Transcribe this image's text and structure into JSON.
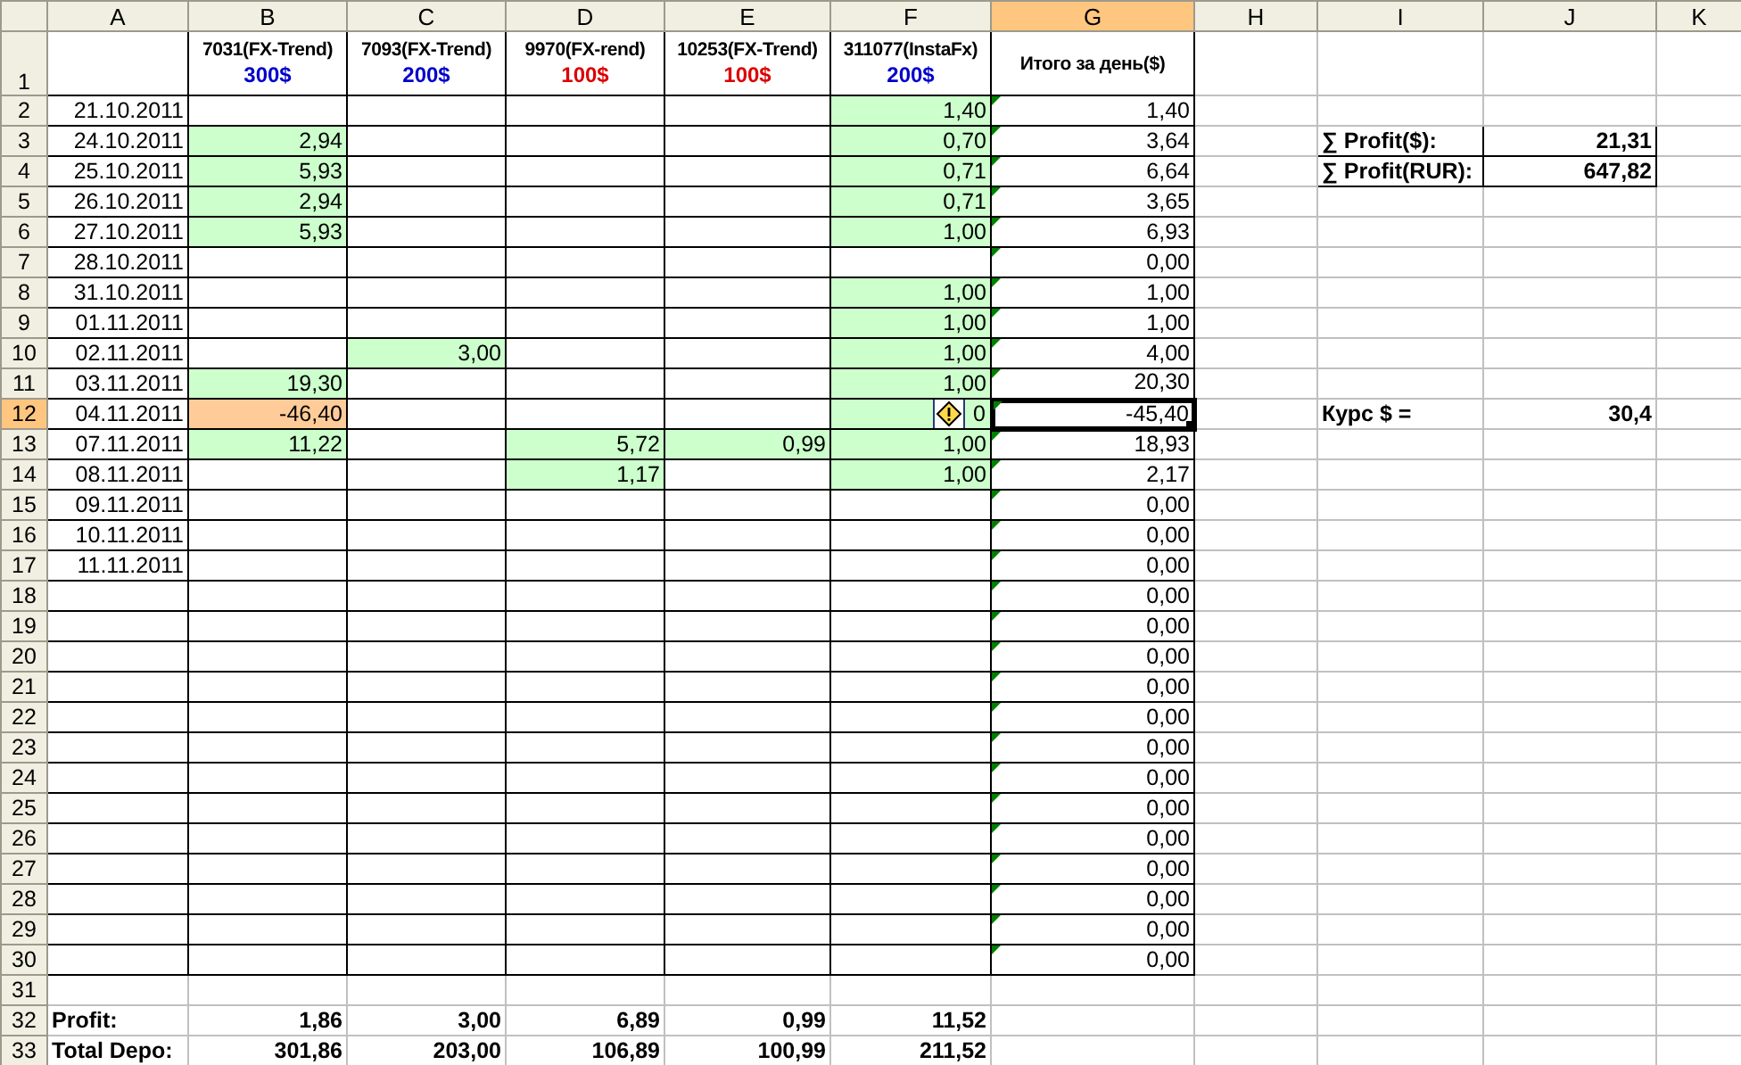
{
  "columns": [
    {
      "label": "A",
      "selected": false
    },
    {
      "label": "B",
      "selected": false
    },
    {
      "label": "C",
      "selected": false
    },
    {
      "label": "D",
      "selected": false
    },
    {
      "label": "E",
      "selected": false
    },
    {
      "label": "F",
      "selected": false
    },
    {
      "label": "G",
      "selected": true
    },
    {
      "label": "H",
      "selected": false
    },
    {
      "label": "I",
      "selected": false
    },
    {
      "label": "J",
      "selected": false
    },
    {
      "label": "K",
      "selected": false
    }
  ],
  "rows": [
    {
      "label": "1",
      "selected": false,
      "ruled": true,
      "cells": [
        {},
        {
          "kind": "header",
          "text": "7031(FX-Trend)",
          "amount": "300$",
          "color": "#0000cc",
          "selected": false
        },
        {
          "kind": "header",
          "text": "7093(FX-Trend)",
          "amount": "200$",
          "color": "#0000cc",
          "selected": false
        },
        {
          "kind": "header",
          "text": "9970(FX-rend)",
          "amount": "100$",
          "color": "#dd0000",
          "selected": false
        },
        {
          "kind": "header",
          "text": "10253(FX-Trend)",
          "amount": "100$",
          "color": "#dd0000",
          "selected": false
        },
        {
          "kind": "header",
          "text": "311077(InstaFx)",
          "amount": "200$",
          "color": "#0000cc",
          "selected": false
        },
        {
          "kind": "header",
          "text": "Итого за день($)",
          "selected": false
        }
      ]
    },
    {
      "label": "2",
      "selected": false,
      "ruled": true,
      "cells": [
        {
          "kind": "date",
          "text": "21.10.2011",
          "selected": false
        },
        {},
        {},
        {},
        {},
        {
          "kind": "number",
          "text": "1,40",
          "color": "#ccffcc",
          "selected": false
        },
        {
          "kind": "number",
          "text": "1,40",
          "flag": true,
          "selected": false
        }
      ]
    },
    {
      "label": "3",
      "selected": false,
      "ruled": true,
      "cells": [
        {
          "kind": "date",
          "text": "24.10.2011",
          "selected": false
        },
        {
          "kind": "number",
          "text": "2,94",
          "color": "#ccffcc",
          "selected": false
        },
        {},
        {},
        {},
        {
          "kind": "number",
          "text": "0,70",
          "color": "#ccffcc",
          "selected": false
        },
        {
          "kind": "number",
          "text": "3,64",
          "flag": true,
          "selected": false
        },
        {},
        {
          "kind": "boxed_label",
          "text": "∑ Profit($):",
          "selected": false
        },
        {
          "kind": "boxed_number",
          "text": "21,31",
          "selected": false
        }
      ]
    },
    {
      "label": "4",
      "selected": false,
      "ruled": true,
      "cells": [
        {
          "kind": "date",
          "text": "25.10.2011",
          "selected": false
        },
        {
          "kind": "number",
          "text": "5,93",
          "color": "#ccffcc",
          "selected": false
        },
        {},
        {},
        {},
        {
          "kind": "number",
          "text": "0,71",
          "color": "#ccffcc",
          "selected": false
        },
        {
          "kind": "number",
          "text": "6,64",
          "flag": true,
          "selected": false
        },
        {},
        {
          "kind": "boxed_label",
          "text": "∑ Profit(RUR):",
          "selected": false
        },
        {
          "kind": "boxed_number",
          "text": "647,82",
          "selected": false
        }
      ]
    },
    {
      "label": "5",
      "selected": false,
      "ruled": true,
      "cells": [
        {
          "kind": "date",
          "text": "26.10.2011",
          "selected": false
        },
        {
          "kind": "number",
          "text": "2,94",
          "color": "#ccffcc",
          "selected": false
        },
        {},
        {},
        {},
        {
          "kind": "number",
          "text": "0,71",
          "color": "#ccffcc",
          "selected": false
        },
        {
          "kind": "number",
          "text": "3,65",
          "flag": true,
          "selected": false
        }
      ]
    },
    {
      "label": "6",
      "selected": false,
      "ruled": true,
      "cells": [
        {
          "kind": "date",
          "text": "27.10.2011",
          "selected": false
        },
        {
          "kind": "number",
          "text": "5,93",
          "color": "#ccffcc",
          "selected": false
        },
        {},
        {},
        {},
        {
          "kind": "number",
          "text": "1,00",
          "color": "#ccffcc",
          "selected": false
        },
        {
          "kind": "number",
          "text": "6,93",
          "flag": true,
          "selected": false
        }
      ]
    },
    {
      "label": "7",
      "selected": false,
      "ruled": true,
      "cells": [
        {
          "kind": "date",
          "text": "28.10.2011",
          "selected": false
        },
        {},
        {},
        {},
        {},
        {},
        {
          "kind": "number",
          "text": "0,00",
          "flag": true,
          "selected": false
        }
      ]
    },
    {
      "label": "8",
      "selected": false,
      "ruled": true,
      "cells": [
        {
          "kind": "date",
          "text": "31.10.2011",
          "selected": false
        },
        {},
        {},
        {},
        {},
        {
          "kind": "number",
          "text": "1,00",
          "color": "#ccffcc",
          "selected": false
        },
        {
          "kind": "number",
          "text": "1,00",
          "flag": true,
          "selected": false
        }
      ]
    },
    {
      "label": "9",
      "selected": false,
      "ruled": true,
      "cells": [
        {
          "kind": "date",
          "text": "01.11.2011",
          "selected": false
        },
        {},
        {},
        {},
        {},
        {
          "kind": "number",
          "text": "1,00",
          "color": "#ccffcc",
          "selected": false
        },
        {
          "kind": "number",
          "text": "1,00",
          "flag": true,
          "selected": false
        }
      ]
    },
    {
      "label": "10",
      "selected": false,
      "ruled": true,
      "cells": [
        {
          "kind": "date",
          "text": "02.11.2011",
          "selected": false
        },
        {},
        {
          "kind": "number",
          "text": "3,00",
          "color": "#ccffcc",
          "selected": false
        },
        {},
        {},
        {
          "kind": "number",
          "text": "1,00",
          "color": "#ccffcc",
          "selected": false
        },
        {
          "kind": "number",
          "text": "4,00",
          "flag": true,
          "selected": false
        }
      ]
    },
    {
      "label": "11",
      "selected": false,
      "ruled": true,
      "cells": [
        {
          "kind": "date",
          "text": "03.11.2011",
          "selected": false
        },
        {
          "kind": "number",
          "text": "19,30",
          "color": "#ccffcc",
          "selected": false
        },
        {},
        {},
        {},
        {
          "kind": "number",
          "text": "1,00",
          "color": "#ccffcc",
          "selected": false
        },
        {
          "kind": "number",
          "text": "20,30",
          "flag": true,
          "selected": false
        }
      ]
    },
    {
      "label": "12",
      "selected": true,
      "ruled": true,
      "cells": [
        {
          "kind": "date",
          "text": "04.11.2011",
          "selected": false
        },
        {
          "kind": "number",
          "text": "-46,40",
          "color": "#ffcc99",
          "selected": false
        },
        {},
        {},
        {},
        {
          "kind": "number",
          "text": "0",
          "color": "#ccffcc",
          "smart_tag": true,
          "selected": false
        },
        {
          "kind": "number",
          "text": "-45,40",
          "flag": true,
          "selected": true
        },
        {},
        {
          "kind": "bold_label",
          "text": "Курс $ =",
          "selected": false
        },
        {
          "kind": "bold_number",
          "text": "30,4",
          "selected": false
        }
      ]
    },
    {
      "label": "13",
      "selected": false,
      "ruled": true,
      "cells": [
        {
          "kind": "date",
          "text": "07.11.2011",
          "selected": false
        },
        {
          "kind": "number",
          "text": "11,22",
          "color": "#ccffcc",
          "selected": false
        },
        {},
        {
          "kind": "number",
          "text": "5,72",
          "color": "#ccffcc",
          "selected": false
        },
        {
          "kind": "number",
          "text": "0,99",
          "color": "#ccffcc",
          "selected": false
        },
        {
          "kind": "number",
          "text": "1,00",
          "color": "#ccffcc",
          "selected": false
        },
        {
          "kind": "number",
          "text": "18,93",
          "flag": true,
          "selected": false
        }
      ]
    },
    {
      "label": "14",
      "selected": false,
      "ruled": true,
      "cells": [
        {
          "kind": "date",
          "text": "08.11.2011",
          "selected": false
        },
        {},
        {},
        {
          "kind": "number",
          "text": "1,17",
          "color": "#ccffcc",
          "selected": false
        },
        {},
        {
          "kind": "number",
          "text": "1,00",
          "color": "#ccffcc",
          "selected": false
        },
        {
          "kind": "number",
          "text": "2,17",
          "flag": true,
          "selected": false
        }
      ]
    },
    {
      "label": "15",
      "selected": false,
      "ruled": true,
      "cells": [
        {
          "kind": "date",
          "text": "09.11.2011",
          "selected": false
        },
        {},
        {},
        {},
        {},
        {},
        {
          "kind": "number",
          "text": "0,00",
          "flag": true,
          "selected": false
        }
      ]
    },
    {
      "label": "16",
      "selected": false,
      "ruled": true,
      "cells": [
        {
          "kind": "date",
          "text": "10.11.2011",
          "selected": false
        },
        {},
        {},
        {},
        {},
        {},
        {
          "kind": "number",
          "text": "0,00",
          "flag": true,
          "selected": false
        }
      ]
    },
    {
      "label": "17",
      "selected": false,
      "ruled": true,
      "cells": [
        {
          "kind": "date",
          "text": "11.11.2011",
          "selected": false
        },
        {},
        {},
        {},
        {},
        {},
        {
          "kind": "number",
          "text": "0,00",
          "flag": true,
          "selected": false
        }
      ]
    },
    {
      "label": "18",
      "selected": false,
      "ruled": true,
      "cells": [
        {},
        {},
        {},
        {},
        {},
        {},
        {
          "kind": "number",
          "text": "0,00",
          "flag": true,
          "selected": false
        }
      ]
    },
    {
      "label": "19",
      "selected": false,
      "ruled": true,
      "cells": [
        {},
        {},
        {},
        {},
        {},
        {},
        {
          "kind": "number",
          "text": "0,00",
          "flag": true,
          "selected": false
        }
      ]
    },
    {
      "label": "20",
      "selected": false,
      "ruled": true,
      "cells": [
        {},
        {},
        {},
        {},
        {},
        {},
        {
          "kind": "number",
          "text": "0,00",
          "flag": true,
          "selected": false
        }
      ]
    },
    {
      "label": "21",
      "selected": false,
      "ruled": true,
      "cells": [
        {},
        {},
        {},
        {},
        {},
        {},
        {
          "kind": "number",
          "text": "0,00",
          "flag": true,
          "selected": false
        }
      ]
    },
    {
      "label": "22",
      "selected": false,
      "ruled": true,
      "cells": [
        {},
        {},
        {},
        {},
        {},
        {},
        {
          "kind": "number",
          "text": "0,00",
          "flag": true,
          "selected": false
        }
      ]
    },
    {
      "label": "23",
      "selected": false,
      "ruled": true,
      "cells": [
        {},
        {},
        {},
        {},
        {},
        {},
        {
          "kind": "number",
          "text": "0,00",
          "flag": true,
          "selected": false
        }
      ]
    },
    {
      "label": "24",
      "selected": false,
      "ruled": true,
      "cells": [
        {},
        {},
        {},
        {},
        {},
        {},
        {
          "kind": "number",
          "text": "0,00",
          "flag": true,
          "selected": false
        }
      ]
    },
    {
      "label": "25",
      "selected": false,
      "ruled": true,
      "cells": [
        {},
        {},
        {},
        {},
        {},
        {},
        {
          "kind": "number",
          "text": "0,00",
          "flag": true,
          "selected": false
        }
      ]
    },
    {
      "label": "26",
      "selected": false,
      "ruled": true,
      "cells": [
        {},
        {},
        {},
        {},
        {},
        {},
        {
          "kind": "number",
          "text": "0,00",
          "flag": true,
          "selected": false
        }
      ]
    },
    {
      "label": "27",
      "selected": false,
      "ruled": true,
      "cells": [
        {},
        {},
        {},
        {},
        {},
        {},
        {
          "kind": "number",
          "text": "0,00",
          "flag": true,
          "selected": false
        }
      ]
    },
    {
      "label": "28",
      "selected": false,
      "ruled": true,
      "cells": [
        {},
        {},
        {},
        {},
        {},
        {},
        {
          "kind": "number",
          "text": "0,00",
          "flag": true,
          "selected": false
        }
      ]
    },
    {
      "label": "29",
      "selected": false,
      "ruled": true,
      "cells": [
        {},
        {},
        {},
        {},
        {},
        {},
        {
          "kind": "number",
          "text": "0,00",
          "flag": true,
          "selected": false
        }
      ]
    },
    {
      "label": "30",
      "selected": false,
      "ruled": true,
      "cells": [
        {},
        {},
        {},
        {},
        {},
        {},
        {
          "kind": "number",
          "text": "0,00",
          "flag": true,
          "selected": false
        }
      ]
    },
    {
      "label": "31",
      "selected": false,
      "ruled": false,
      "cells": []
    },
    {
      "label": "32",
      "selected": false,
      "ruled": false,
      "cells": [
        {
          "kind": "bold_label",
          "text": "Profit:",
          "selected": false
        },
        {
          "kind": "bold_number",
          "text": "1,86",
          "selected": false
        },
        {
          "kind": "bold_number",
          "text": "3,00",
          "selected": false
        },
        {
          "kind": "bold_number",
          "text": "6,89",
          "selected": false
        },
        {
          "kind": "bold_number",
          "text": "0,99",
          "selected": false
        },
        {
          "kind": "bold_number",
          "text": "11,52",
          "selected": false
        }
      ]
    },
    {
      "label": "33",
      "selected": false,
      "ruled": false,
      "cells": [
        {
          "kind": "bold_label",
          "text": "Total Depo:",
          "selected": false
        },
        {
          "kind": "bold_number",
          "text": "301,86",
          "selected": false
        },
        {
          "kind": "bold_number",
          "text": "203,00",
          "selected": false
        },
        {
          "kind": "bold_number",
          "text": "106,89",
          "selected": false
        },
        {
          "kind": "bold_number",
          "text": "100,99",
          "selected": false
        },
        {
          "kind": "bold_number",
          "text": "211,52",
          "selected": false
        }
      ]
    }
  ]
}
